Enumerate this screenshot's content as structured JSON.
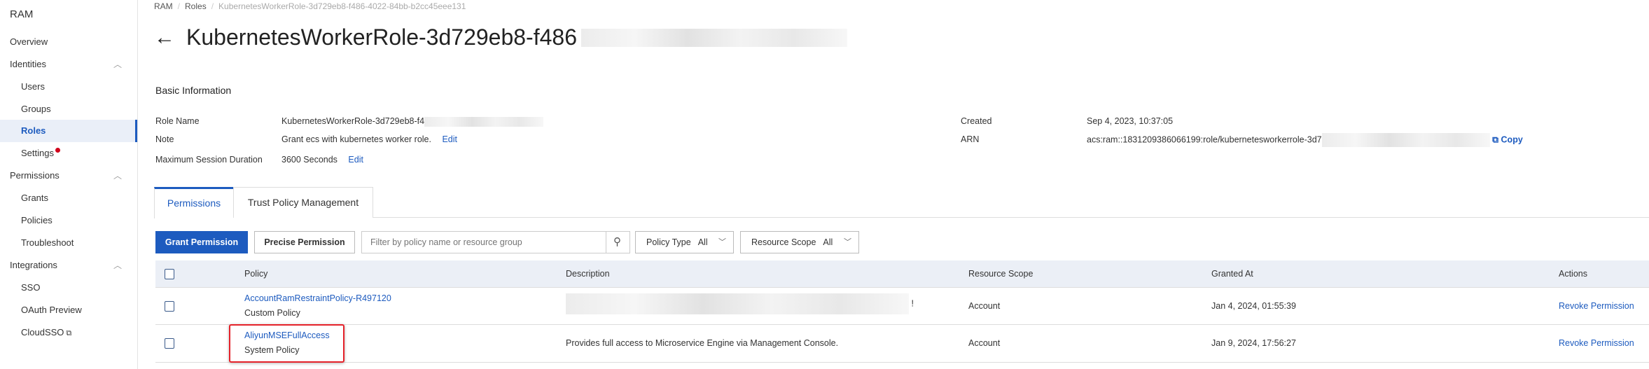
{
  "sidebar": {
    "title": "RAM",
    "items": [
      {
        "label": "Overview"
      },
      {
        "label": "Identities"
      },
      {
        "label": "Users"
      },
      {
        "label": "Groups"
      },
      {
        "label": "Roles"
      },
      {
        "label": "Settings"
      },
      {
        "label": "Permissions"
      },
      {
        "label": "Grants"
      },
      {
        "label": "Policies"
      },
      {
        "label": "Troubleshoot"
      },
      {
        "label": "Integrations"
      },
      {
        "label": "SSO"
      },
      {
        "label": "OAuth Preview"
      },
      {
        "label": "CloudSSO"
      }
    ]
  },
  "breadcrumb": [
    "RAM",
    "Roles",
    "KubernetesWorkerRole-3d729eb8-f486-4022-84bb-b2cc45eee131"
  ],
  "title": "KubernetesWorkerRole-3d729eb8-f486",
  "basic": {
    "heading": "Basic Information",
    "role_name_label": "Role Name",
    "role_name": "KubernetesWorkerRole-3d729eb8-f4",
    "note_label": "Note",
    "note": "Grant ecs with kubernetes worker role.",
    "edit": "Edit",
    "duration_label": "Maximum Session Duration",
    "duration": "3600 Seconds",
    "created_label": "Created",
    "created": "Sep 4, 2023, 10:37:05",
    "arn_label": "ARN",
    "arn": "acs:ram::1831209386066199:role/kubernetesworkerrole-3d7",
    "copy": "Copy"
  },
  "tabs": [
    "Permissions",
    "Trust Policy Management"
  ],
  "toolbar": {
    "grant": "Grant Permission",
    "precise": "Precise Permission",
    "filter_placeholder": "Filter by policy name or resource group",
    "policy_type_label": "Policy Type",
    "policy_type_value": "All",
    "scope_label": "Resource Scope",
    "scope_value": "All"
  },
  "table": {
    "headers": [
      "Policy",
      "Description",
      "Resource Scope",
      "Granted At",
      "Actions"
    ],
    "rows": [
      {
        "policy": "AccountRamRestraintPolicy-R497120",
        "type": "Custom Policy",
        "description": "!",
        "scope": "Account",
        "granted": "Jan 4, 2024, 01:55:39",
        "action": "Revoke Permission"
      },
      {
        "policy": "AliyunMSEFullAccess",
        "type": "System Policy",
        "description": "Provides full access to Microservice Engine via Management Console.",
        "scope": "Account",
        "granted": "Jan 9, 2024, 17:56:27",
        "action": "Revoke Permission"
      }
    ]
  },
  "colors": {
    "accent": "#1d5bbf",
    "highlight": "#e5222a",
    "header_bg": "#ebeff6"
  }
}
